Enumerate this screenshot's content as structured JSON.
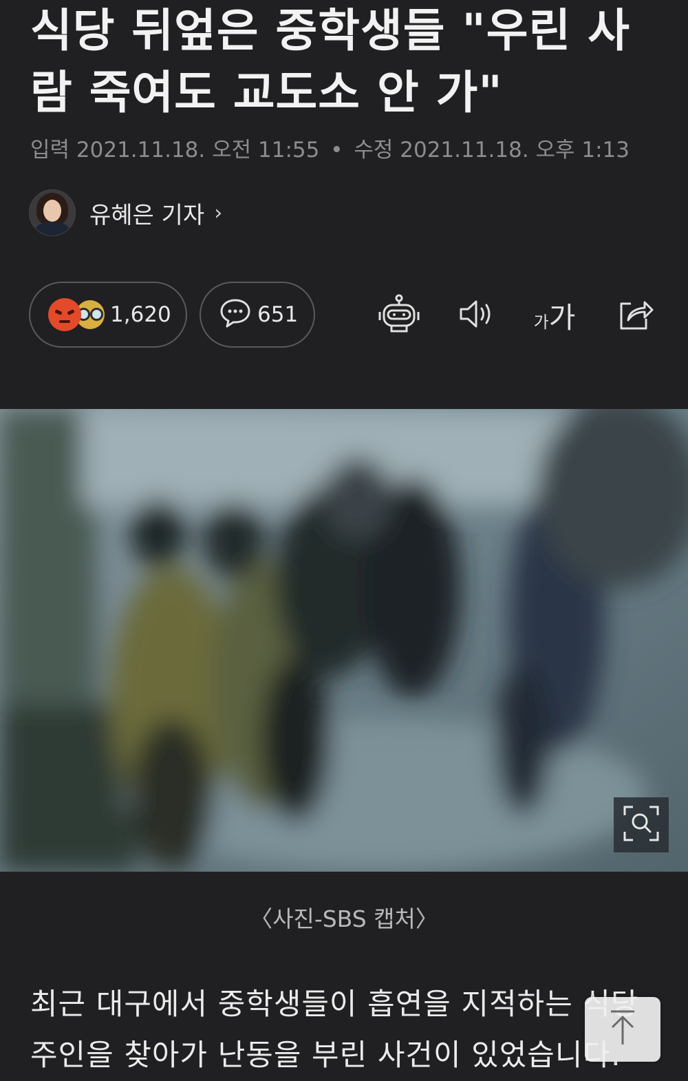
{
  "article": {
    "headline": "식당 뒤엎은 중학생들 \"우린 사람 죽여도 교도소 안 가\"",
    "published_label": "입력",
    "published": "2021.11.18. 오전 11:55",
    "separator": "•",
    "modified_label": "수정",
    "modified": "2021.11.18. 오후 1:13",
    "author": "유혜은 기자",
    "author_chevron": "›"
  },
  "actions": {
    "reaction_count": "1,620",
    "comment_count": "651",
    "font_small": "가",
    "font_big": "가",
    "tools": [
      "robot-icon",
      "speaker-icon",
      "font-size-icon",
      "share-icon"
    ]
  },
  "image": {
    "caption": "〈사진-SBS 캡처〉"
  },
  "body": {
    "text": "최근 대구에서 중학생들이 흡연을 지적하는 식당 주인을 찾아가 난동을 부린 사건이 있었습니다."
  },
  "colors": {
    "background": "#202022",
    "angry_emoji": "#e24a2a",
    "glasses_emoji": "#d9b040"
  }
}
